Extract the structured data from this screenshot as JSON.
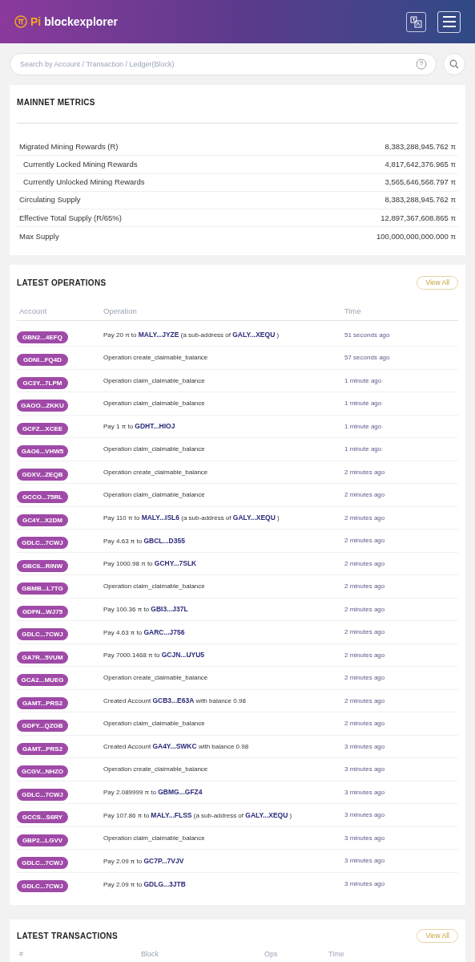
{
  "header": {
    "logo_pi": "Pi",
    "logo_text": "blockexplorer"
  },
  "search": {
    "placeholder": "Search by Account / Transaction / Ledger(Block)"
  },
  "metrics": {
    "title": "MAINNET METRICS",
    "rows": [
      {
        "label": "Migrated Mining Rewards (R)",
        "value": "8,383,288,945.762 π",
        "indented": false
      },
      {
        "label": "Currently Locked Mining Rewards",
        "value": "4,817,642,376.965 π",
        "indented": true
      },
      {
        "label": "Currently Unlocked Mining Rewards",
        "value": "3,565,646,568.797 π",
        "indented": true
      },
      {
        "label": "Circulating Supply",
        "value": "8,383,288,945.762 π",
        "indented": false
      },
      {
        "label": "Effective Total Supply (R/65%)",
        "value": "12,897,367,608.865 π",
        "indented": false
      },
      {
        "label": "Max Supply",
        "value": "100,000,000,000.000 π",
        "indented": false
      }
    ]
  },
  "operations": {
    "title": "LATEST OPERATIONS",
    "view_all": "View All",
    "columns": [
      "Account",
      "Operation",
      "Time"
    ],
    "rows": [
      {
        "account": "GBN2...4EFQ",
        "operation": [
          {
            "text": "Pay 20 π to",
            "link": false
          },
          {
            "text": "MALY...JYZE",
            "link": true
          },
          {
            "text": "(a sub-address of",
            "link": false
          },
          {
            "text": "GALY...XEQU",
            "link": true
          },
          {
            "text": ")",
            "link": false
          }
        ],
        "time": "51 seconds ago"
      },
      {
        "account": "GDNI...FQ4D",
        "operation": [
          {
            "text": "Operation create_claimable_balance",
            "link": false
          }
        ],
        "time": "57 seconds ago"
      },
      {
        "account": "GC3Y...7LPM",
        "operation": [
          {
            "text": "Operation claim_claimable_balance",
            "link": false
          }
        ],
        "time": "1 minute ago"
      },
      {
        "account": "GAOO...ZKKU",
        "operation": [
          {
            "text": "Operation claim_claimable_balance",
            "link": false
          }
        ],
        "time": "1 minute ago"
      },
      {
        "account": "GCFZ...XCEE",
        "operation": [
          {
            "text": "Pay 1 π to",
            "link": false
          },
          {
            "text": "GDHT...HIOJ",
            "link": true
          }
        ],
        "time": "1 minute ago"
      },
      {
        "account": "GAO6...VHW5",
        "operation": [
          {
            "text": "Operation claim_claimable_balance",
            "link": false
          }
        ],
        "time": "1 minute ago"
      },
      {
        "account": "GDXV...ZEQB",
        "operation": [
          {
            "text": "Operation create_claimable_balance",
            "link": false
          }
        ],
        "time": "2 minutes ago"
      },
      {
        "account": "GCCO...75RL",
        "operation": [
          {
            "text": "Operation claim_claimable_balance",
            "link": false
          }
        ],
        "time": "2 minutes ago"
      },
      {
        "account": "GC4Y...X2DM",
        "operation": [
          {
            "text": "Pay 110 π to",
            "link": false
          },
          {
            "text": "MALY...ISL6",
            "link": true
          },
          {
            "text": "(a sub-address of",
            "link": false
          },
          {
            "text": "GALY...XEQU",
            "link": true
          },
          {
            "text": ")",
            "link": false
          }
        ],
        "time": "2 minutes ago"
      },
      {
        "account": "GDLC...7CWJ",
        "operation": [
          {
            "text": "Pay 4.63 π to",
            "link": false
          },
          {
            "text": "GBCL...D355",
            "link": true
          }
        ],
        "time": "2 minutes ago"
      },
      {
        "account": "GBC6...RINW",
        "operation": [
          {
            "text": "Pay 1000.98 π to",
            "link": false
          },
          {
            "text": "GCHY...7SLK",
            "link": true
          }
        ],
        "time": "2 minutes ago"
      },
      {
        "account": "GBMB...L7TG",
        "operation": [
          {
            "text": "Operation claim_claimable_balance",
            "link": false
          }
        ],
        "time": "2 minutes ago"
      },
      {
        "account": "GDFN...WJ75",
        "operation": [
          {
            "text": "Pay 100.36 π to",
            "link": false
          },
          {
            "text": "GBI3...J37L",
            "link": true
          }
        ],
        "time": "2 minutes ago"
      },
      {
        "account": "GDLC...7CWJ",
        "operation": [
          {
            "text": "Pay 4.63 π to",
            "link": false
          },
          {
            "text": "GARC...J756",
            "link": true
          }
        ],
        "time": "2 minutes ago"
      },
      {
        "account": "GA7R...5VUM",
        "operation": [
          {
            "text": "Pay 7000.1468 π to",
            "link": false
          },
          {
            "text": "GCJN...UYU5",
            "link": true
          }
        ],
        "time": "2 minutes ago"
      },
      {
        "account": "GCA2...MUEG",
        "operation": [
          {
            "text": "Operation create_claimable_balance",
            "link": false
          }
        ],
        "time": "2 minutes ago"
      },
      {
        "account": "GAMT...PRS2",
        "operation": [
          {
            "text": "Created Account",
            "link": false
          },
          {
            "text": "GCB3...E63A",
            "link": true
          },
          {
            "text": "with balance 0.98",
            "link": false
          }
        ],
        "time": "2 minutes ago"
      },
      {
        "account": "GDFY...QZGB",
        "operation": [
          {
            "text": "Operation claim_claimable_balance",
            "link": false
          }
        ],
        "time": "2 minutes ago"
      },
      {
        "account": "GAMT...PRS2",
        "operation": [
          {
            "text": "Created Account",
            "link": false
          },
          {
            "text": "GA4Y...SWKC",
            "link": true
          },
          {
            "text": "with balance 0.98",
            "link": false
          }
        ],
        "time": "3 minutes ago"
      },
      {
        "account": "GCGV...NHZO",
        "operation": [
          {
            "text": "Operation create_claimable_balance",
            "link": false
          }
        ],
        "time": "3 minutes ago"
      },
      {
        "account": "GDLC...7CWJ",
        "operation": [
          {
            "text": "Pay 2.089999 π to",
            "link": false
          },
          {
            "text": "GBMG...GFZ4",
            "link": true
          }
        ],
        "time": "3 minutes ago"
      },
      {
        "account": "GCCS...S6RY",
        "operation": [
          {
            "text": "Pay 107.86 π to",
            "link": false
          },
          {
            "text": "MALY...FLSS",
            "link": true
          },
          {
            "text": "(a sub-address of",
            "link": false
          },
          {
            "text": "GALY...XEQU",
            "link": true
          },
          {
            "text": ")",
            "link": false
          }
        ],
        "time": "3 minutes ago"
      },
      {
        "account": "GBP2...LGVV",
        "operation": [
          {
            "text": "Operation claim_claimable_balance",
            "link": false
          }
        ],
        "time": "3 minutes ago"
      },
      {
        "account": "GDLC...7CWJ",
        "operation": [
          {
            "text": "Pay 2.09 π to",
            "link": false
          },
          {
            "text": "GC7P...7VJV",
            "link": true
          }
        ],
        "time": "3 minutes ago"
      },
      {
        "account": "GDLC...7CWJ",
        "operation": [
          {
            "text": "Pay 2.09 π to",
            "link": false
          },
          {
            "text": "GDLG...3JTB",
            "link": true
          }
        ],
        "time": "3 minutes ago"
      }
    ]
  },
  "transactions": {
    "title": "LATEST TRANSACTIONS",
    "view_all": "View All",
    "columns": [
      "#",
      "Block",
      "Ops",
      "Time"
    ]
  }
}
